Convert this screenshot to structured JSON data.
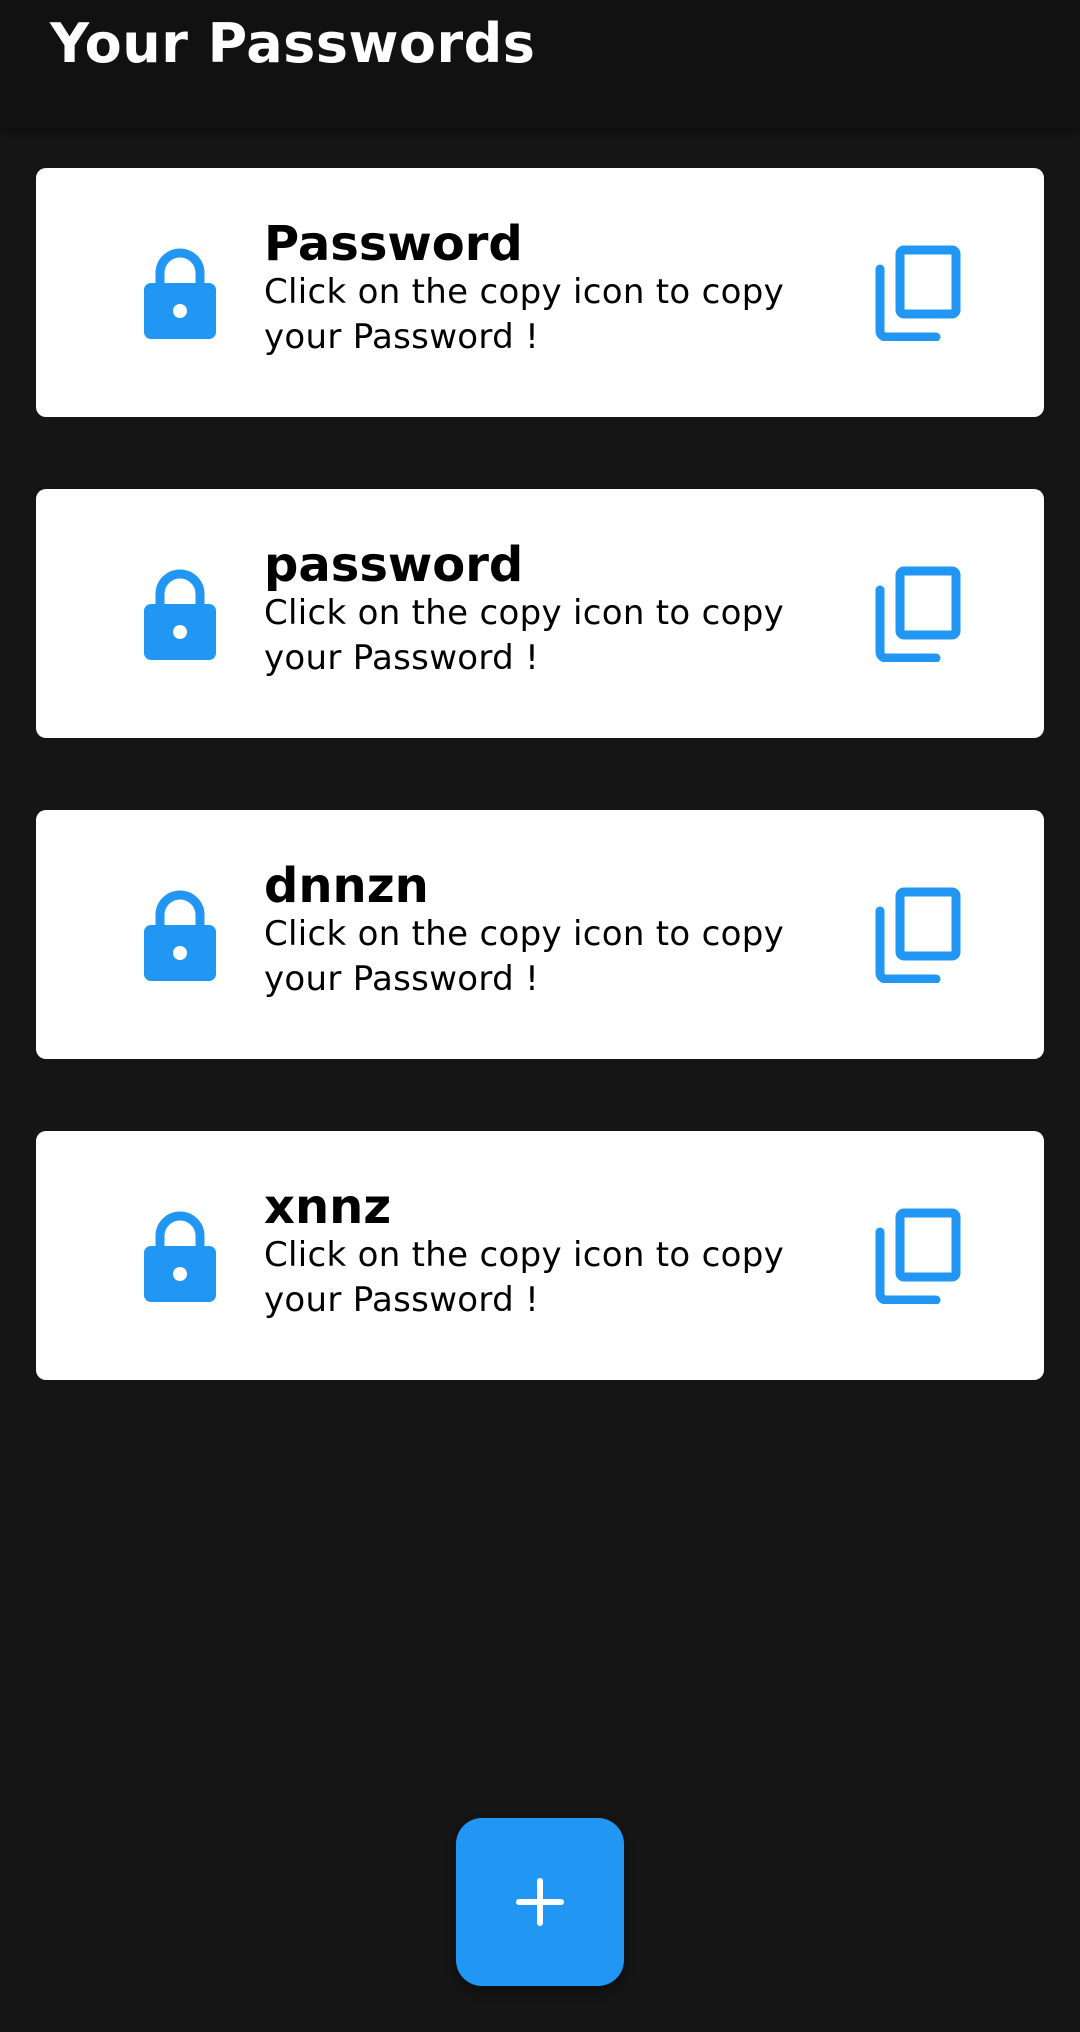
{
  "app_bar": {
    "title": "Your Passwords"
  },
  "colors": {
    "accent": "#2196f3",
    "background": "#151515",
    "card": "#ffffff"
  },
  "passwords": [
    {
      "title": "Password",
      "description": "Click on the copy icon to copy your Password !",
      "icon": "lock-icon",
      "action_icon": "copy-icon"
    },
    {
      "title": "password",
      "description": "Click on the copy icon to copy your Password !",
      "icon": "lock-icon",
      "action_icon": "copy-icon"
    },
    {
      "title": "dnnzn",
      "description": "Click on the copy icon to copy your Password !",
      "icon": "lock-icon",
      "action_icon": "copy-icon"
    },
    {
      "title": "xnnz",
      "description": "Click on the copy icon to copy your Password !",
      "icon": "lock-icon",
      "action_icon": "copy-icon"
    }
  ],
  "fab": {
    "icon": "plus-icon"
  }
}
